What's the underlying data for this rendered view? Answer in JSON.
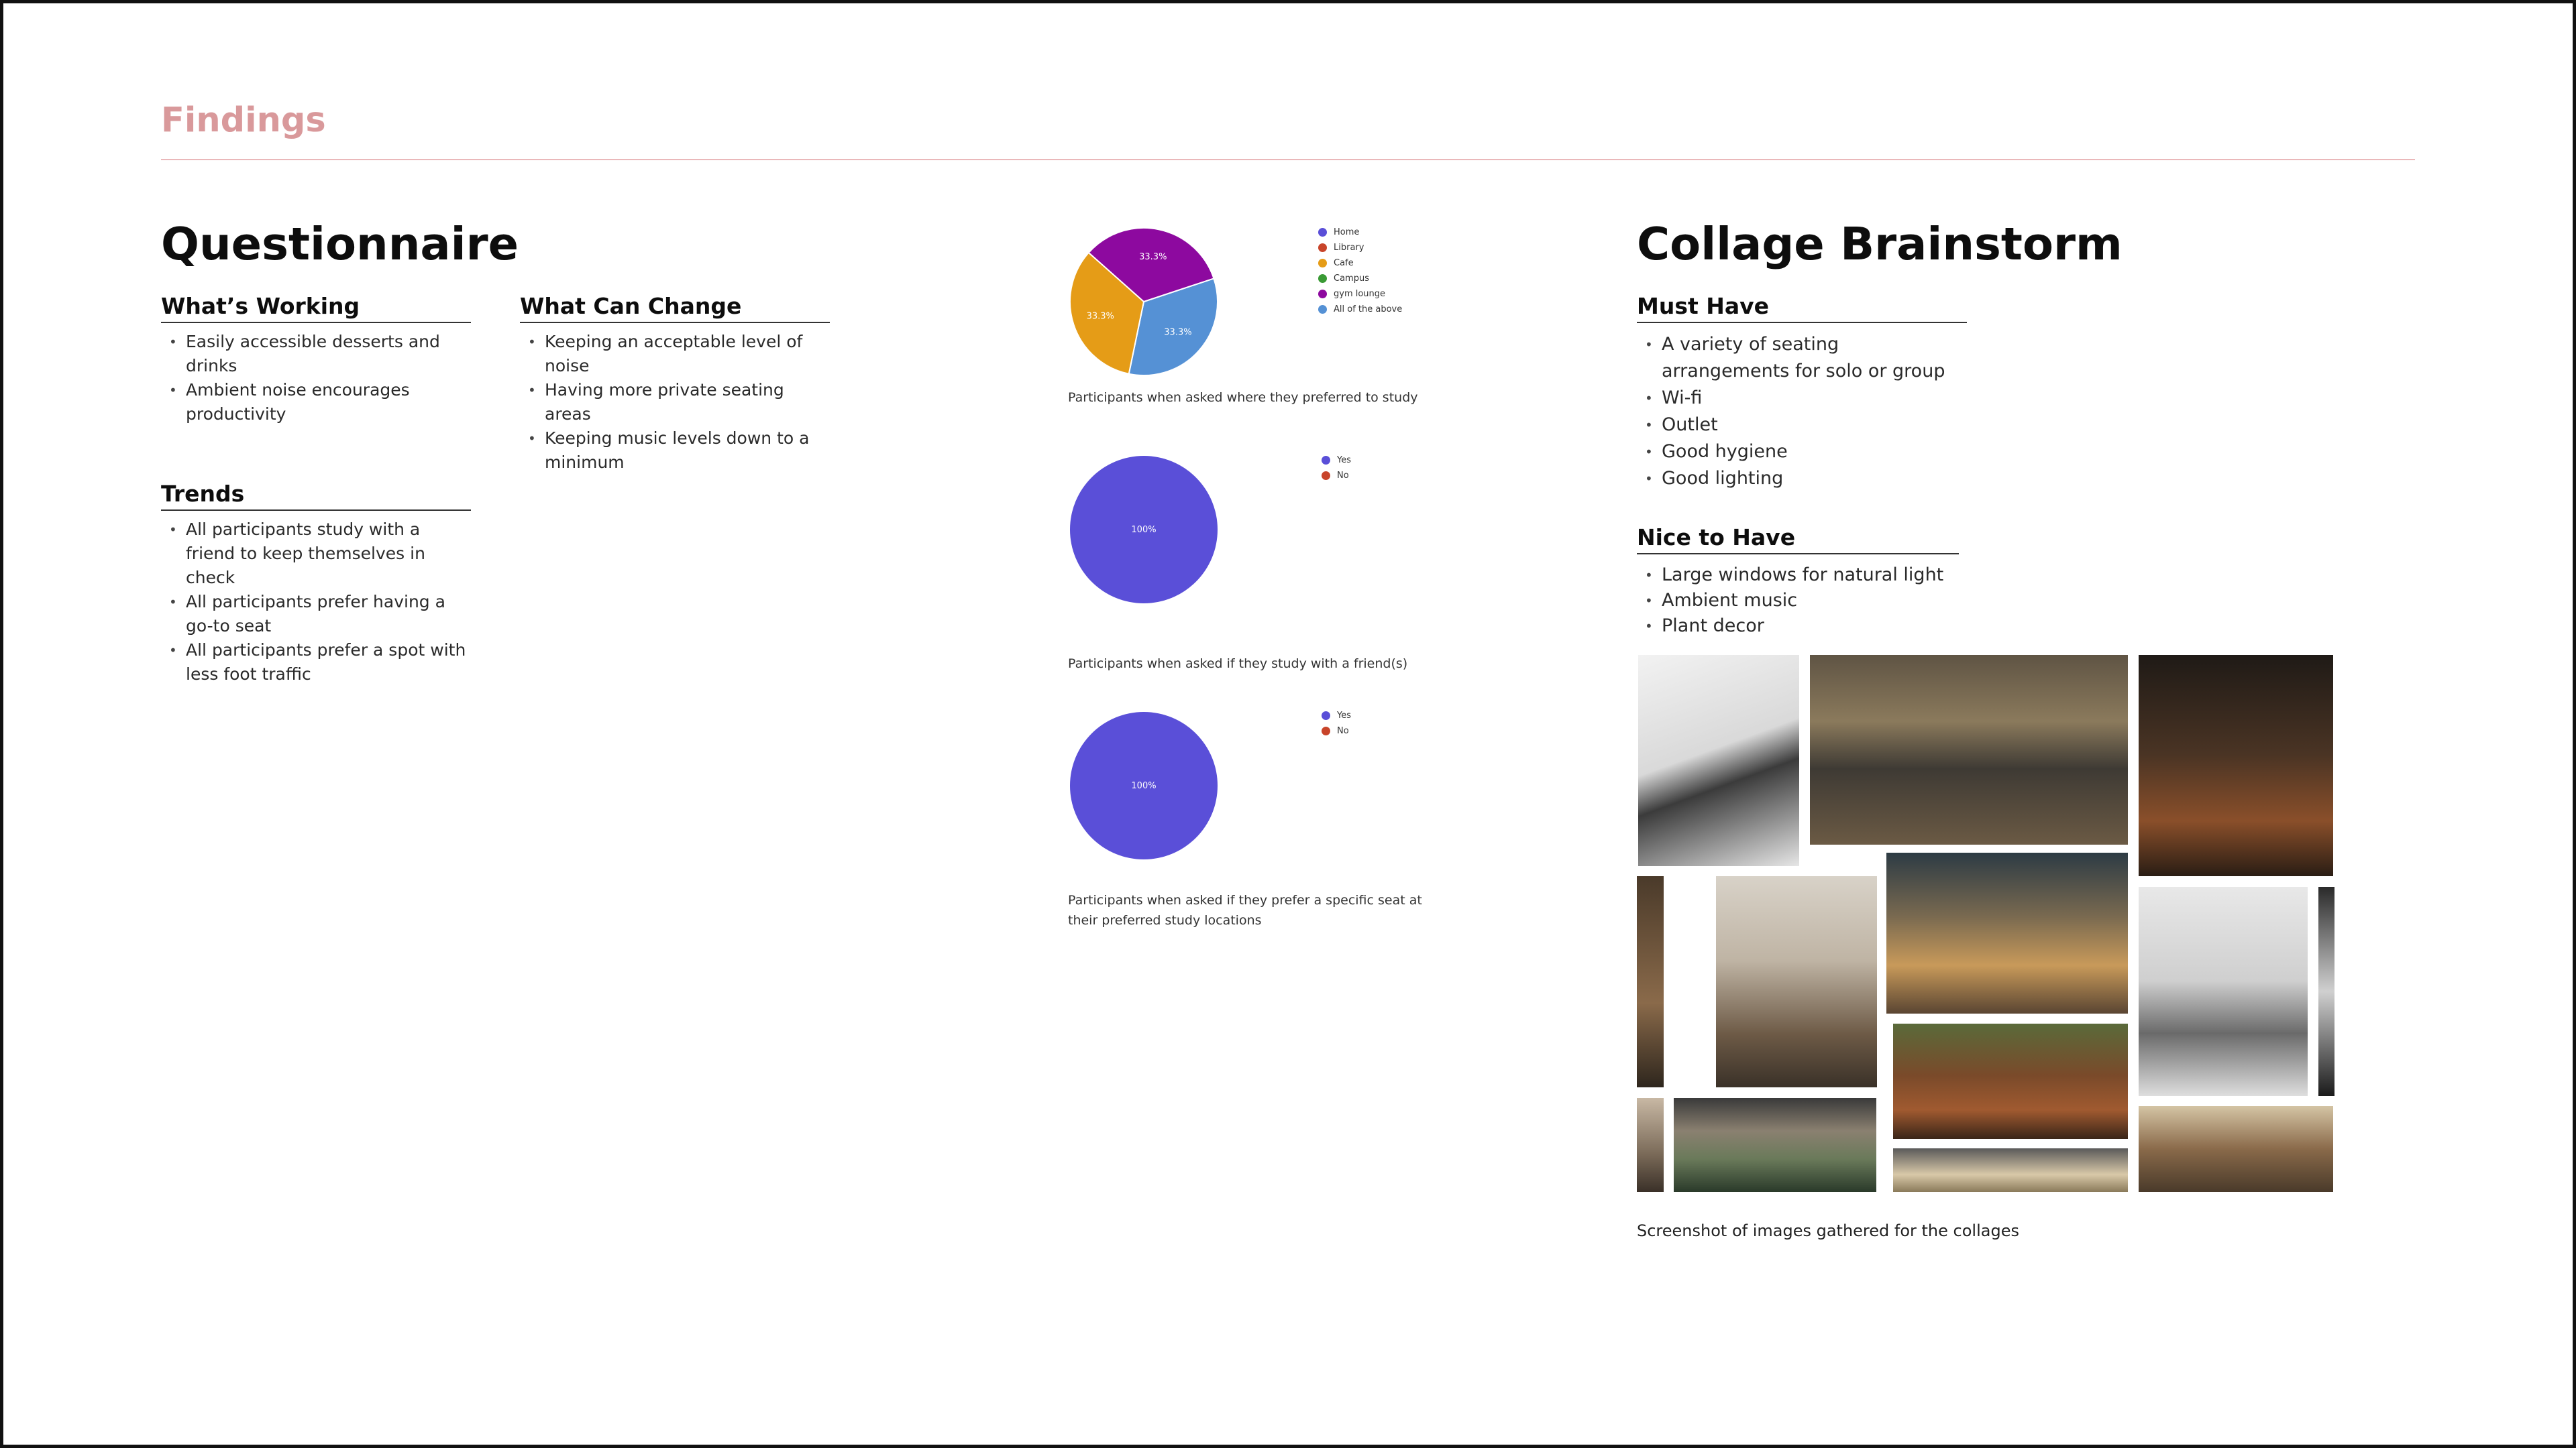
{
  "colors": {
    "accent": "#d9999b",
    "rule": "#eab8ba",
    "pie_home": "#5a4fd8",
    "pie_library": "#c8442a",
    "pie_cafe": "#e59c17",
    "pie_campus": "#3a9a35",
    "pie_gym": "#8d099f",
    "pie_all": "#5591d5"
  },
  "findings": {
    "title": "Findings"
  },
  "questionnaire": {
    "title": "Questionnaire",
    "working": {
      "heading": "What’s Working",
      "items": [
        "Easily accessible desserts and drinks",
        "Ambient noise encourages productivity"
      ]
    },
    "change": {
      "heading": "What Can Change",
      "items": [
        "Keeping an acceptable level of noise",
        "Having more private seating areas",
        "Keeping music levels down to a minimum"
      ]
    },
    "trends": {
      "heading": "Trends",
      "items": [
        "All participants study with a friend to keep themselves in check",
        "All participants prefer having a go-to seat",
        "All participants prefer a spot with less foot traffic"
      ]
    }
  },
  "chart_data": [
    {
      "type": "pie",
      "categories": [
        "Home",
        "Library",
        "Cafe",
        "Campus",
        "gym lounge",
        "All of the above"
      ],
      "values": [
        0,
        0,
        33.3,
        0,
        33.3,
        33.3
      ],
      "slice_labels": [
        "",
        "",
        "33.3%",
        "",
        "33.3%",
        "33.3%"
      ],
      "caption": "Participants when asked where they preferred to study"
    },
    {
      "type": "pie",
      "categories": [
        "Yes",
        "No"
      ],
      "values": [
        100,
        0
      ],
      "slice_labels": [
        "100%",
        ""
      ],
      "caption": "Participants when asked if they study with a friend(s)"
    },
    {
      "type": "pie",
      "categories": [
        "Yes",
        "No"
      ],
      "values": [
        100,
        0
      ],
      "slice_labels": [
        "100%",
        ""
      ],
      "caption": "Participants when asked if they prefer a specific seat at their preferred study locations"
    }
  ],
  "collage": {
    "title": "Collage Brainstorm",
    "must": {
      "heading": "Must Have",
      "items": [
        "A variety of seating arrangements for solo or group",
        "Wi-fi",
        "Outlet",
        "Good hygiene",
        "Good lighting"
      ]
    },
    "nice": {
      "heading": "Nice to Have",
      "items": [
        "Large windows for natural light",
        "Ambient music",
        "Plant decor"
      ]
    },
    "caption": "Screenshot of images gathered for the collages"
  }
}
